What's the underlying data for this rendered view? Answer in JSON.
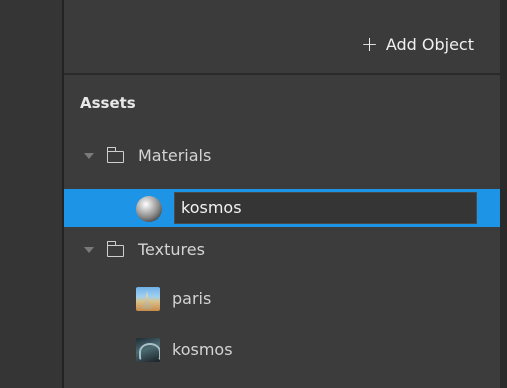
{
  "toolbar": {
    "add_object_icon": "+",
    "add_object_label": "Add Object"
  },
  "assets": {
    "title": "Assets",
    "materials_folder": {
      "label": "Materials",
      "icon": "folder-icon",
      "expanded": true
    },
    "material_items": [
      {
        "label": "kosmos",
        "icon": "sphere-material-icon",
        "selected": true
      }
    ],
    "textures_folder": {
      "label": "Textures",
      "icon": "folder-icon",
      "expanded": true
    },
    "texture_items": [
      {
        "label": "paris",
        "icon": "paris-thumbnail-icon"
      },
      {
        "label": "kosmos",
        "icon": "kosmos-thumbnail-icon"
      }
    ]
  },
  "colors": {
    "selection": "#1d94e6",
    "panel": "#3c3c3c"
  }
}
